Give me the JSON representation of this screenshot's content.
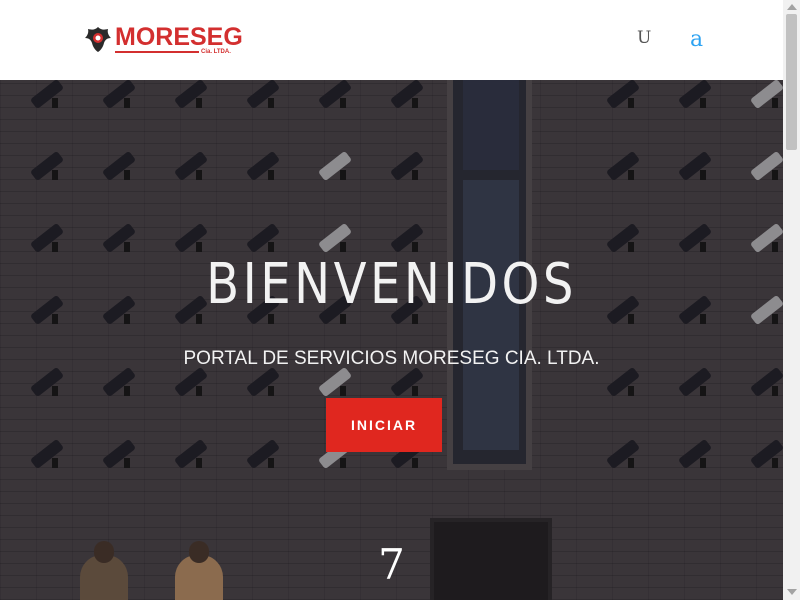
{
  "header": {
    "logo": {
      "brand": "MORESEG",
      "suffix": "Cia. LTDA.",
      "emblem_icon": "eagle-emblem-icon"
    },
    "nav": {
      "item1": "U",
      "item2": "a"
    }
  },
  "hero": {
    "title": "BIENVENIDOS",
    "subtitle": "PORTAL DE SERVICIOS MORESEG CIA. LTDA.",
    "button_label": "INICIAR",
    "number": "7"
  },
  "colors": {
    "brand_red": "#d32f2f",
    "button_red": "#e0271f",
    "nav_link_blue": "#2ea3f2"
  }
}
